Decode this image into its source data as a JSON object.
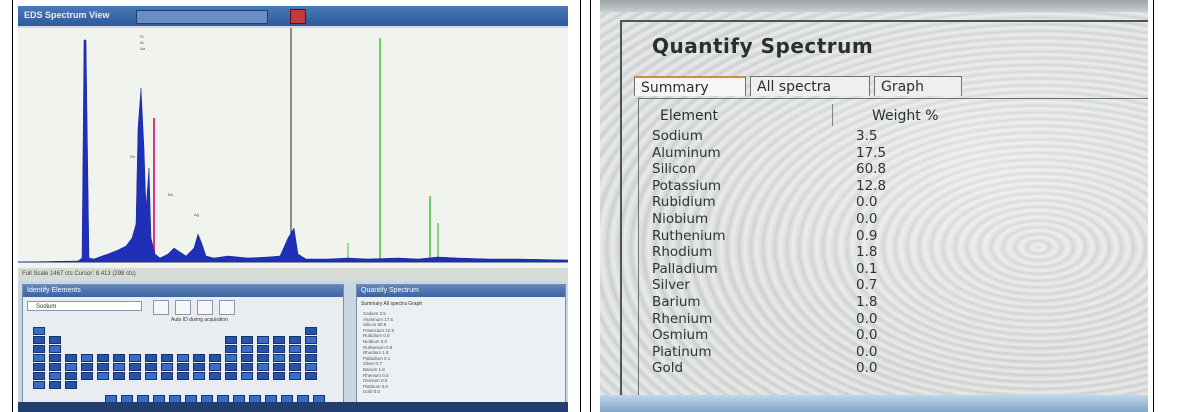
{
  "left_screen": {
    "window_title": "EDS Spectrum View",
    "spectrum_status": "Full Scale 1467 cts Cursor: 8.413 (298 cts)",
    "identify_panel_title": "Identify Elements",
    "identify_select_value": "Sodium",
    "auto_id_label": "Auto ID during acquisition",
    "quantify_panel_title": "Quantify Spectrum",
    "quantify_tabs": "Summary  All spectra  Graph",
    "colors": {
      "spectrum": "#1f2fb8",
      "marker_pink": "#e0338a",
      "marker_green": "#3cc43c",
      "cursor": "#222222"
    }
  },
  "right_screen": {
    "title": "Quantify Spectrum",
    "tabs": [
      {
        "label": "Summary",
        "active": true
      },
      {
        "label": "All spectra",
        "active": false
      },
      {
        "label": "Graph",
        "active": false
      }
    ],
    "columns": {
      "element": "Element",
      "weight": "Weight %"
    },
    "rows": [
      {
        "element": "Sodium",
        "weight": "3.5"
      },
      {
        "element": "Aluminum",
        "weight": "17.5"
      },
      {
        "element": "Silicon",
        "weight": "60.8"
      },
      {
        "element": "Potassium",
        "weight": "12.8"
      },
      {
        "element": "Rubidium",
        "weight": "0.0"
      },
      {
        "element": "Niobium",
        "weight": "0.0"
      },
      {
        "element": "Ruthenium",
        "weight": "0.9"
      },
      {
        "element": "Rhodium",
        "weight": "1.8"
      },
      {
        "element": "Palladium",
        "weight": "0.1"
      },
      {
        "element": "Silver",
        "weight": "0.7"
      },
      {
        "element": "Barium",
        "weight": "1.8"
      },
      {
        "element": "Rhenium",
        "weight": "0.0"
      },
      {
        "element": "Osmium",
        "weight": "0.0"
      },
      {
        "element": "Platinum",
        "weight": "0.0"
      },
      {
        "element": "Gold",
        "weight": "0.0"
      }
    ]
  }
}
